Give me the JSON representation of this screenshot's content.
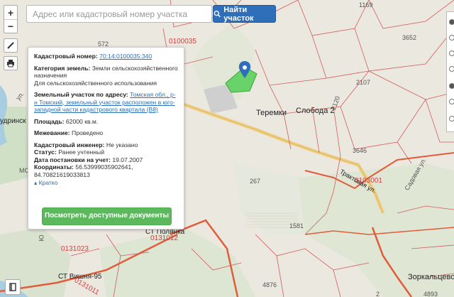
{
  "search": {
    "placeholder": "Адрес или кадастровый номер участка",
    "value": "",
    "button_label": "Найти участок"
  },
  "controls": {
    "zoom_in": "+",
    "zoom_out": "−"
  },
  "popup": {
    "cadastral_number_label": "Кадастровый номер:",
    "cadastral_number": "70:14:0100035:340",
    "land_category_label": "Категория земель:",
    "land_category": "Земли сельскохозяйственного назначения",
    "permitted_use": "Для сельскохозяйственного использования",
    "address_label": "Земельный участок по адресу:",
    "address": "Томская обл., р-н Томский, земельный участок расположен в юго-западной части кадастрового квартала (В8)",
    "area_label": "Площадь:",
    "area": "62000 кв.м.",
    "survey_label": "Межевание:",
    "survey": "Проведено",
    "engineer_label": "Кадастровый инженер:",
    "engineer": "Не указано",
    "status_label": "Статус:",
    "status": "Ранее учтенный",
    "registered_label": "Дата постановки на учет:",
    "registered": "19.07.2007",
    "coords_label": "Координаты:",
    "coords": "56.53999035902641, 84.70821619033813",
    "collapse_label": "Кратко",
    "docs_button": "Посмотреть доступные документы"
  },
  "map_labels": {
    "block_0100035": "0100035",
    "n572": "572",
    "n1169": "1169",
    "n3652": "3652",
    "n2107": "2107",
    "n2120": "2120",
    "n3646": "3646",
    "teremki": "Теремки",
    "sloboda": "Слобода 2",
    "block_0103001": "0103001",
    "traktovaya": "Трактовая ул.",
    "sadovaya": "Садовая ул.",
    "n267": "267",
    "n1581": "1581",
    "st_polyanka": "СТ Полянка",
    "block_0131012": "0131012",
    "block_0131023": "0131023",
    "st_vishnya": "СТ Вишня-95",
    "block_0131011": "0131011",
    "zorkaltsevo": "Зоркальцево",
    "n4876": "4876",
    "n4893": "4893",
    "n2": "2",
    "fragment_left": "удринск",
    "fragment_ul": "ул.",
    "fragment_mc": "МС",
    "fragment_roch": "Ю"
  }
}
